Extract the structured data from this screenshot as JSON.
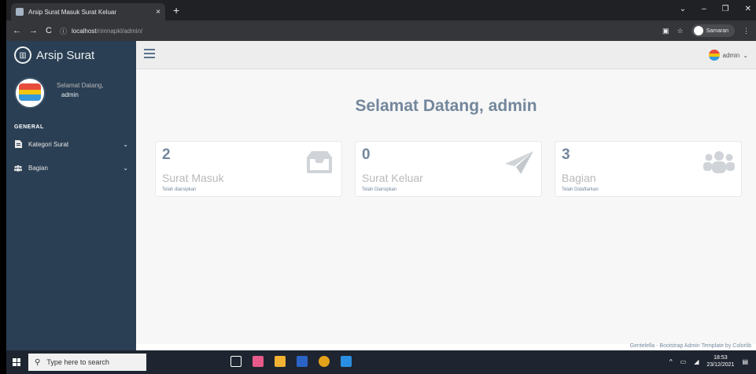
{
  "browser": {
    "tab_title": "Arsip Surat Masuk Surat Keluar",
    "tab_close": "×",
    "new_tab": "+",
    "url_host": "localhost",
    "url_path": "/rimnapkl/admin/",
    "profile_name": "Samaran",
    "window_controls": [
      "⌄",
      "–",
      "❐",
      "✕"
    ]
  },
  "sidebar": {
    "brand": "Arsip Surat",
    "welcome": "Selamat Datang,",
    "username": "admin",
    "section": "GENERAL",
    "items": [
      {
        "label": "Kategori Surat",
        "icon": "file-icon"
      },
      {
        "label": "Bagian",
        "icon": "users-icon"
      }
    ]
  },
  "topnav": {
    "user": "admin"
  },
  "main": {
    "headline": "Selamat Datang, admin",
    "cards": [
      {
        "count": "2",
        "label": "Surat Masuk",
        "sub": "Telah diarsipkan",
        "icon": "inbox-icon"
      },
      {
        "count": "0",
        "label": "Surat Keluar",
        "sub": "Telah Diarsipkan",
        "icon": "paper-plane-icon"
      },
      {
        "count": "3",
        "label": "Bagian",
        "sub": "Telah Didaftarkan",
        "icon": "users-icon"
      }
    ]
  },
  "footer": {
    "text": "Gentelella - Bootstrap Admin Template by Colorlib"
  },
  "taskbar": {
    "search_placeholder": "Type here to search",
    "time": "18:53",
    "date": "23/12/2021"
  },
  "colors": {
    "sidebar": "#2a3f54",
    "text": "#73879c",
    "muted": "#bab8b8"
  }
}
